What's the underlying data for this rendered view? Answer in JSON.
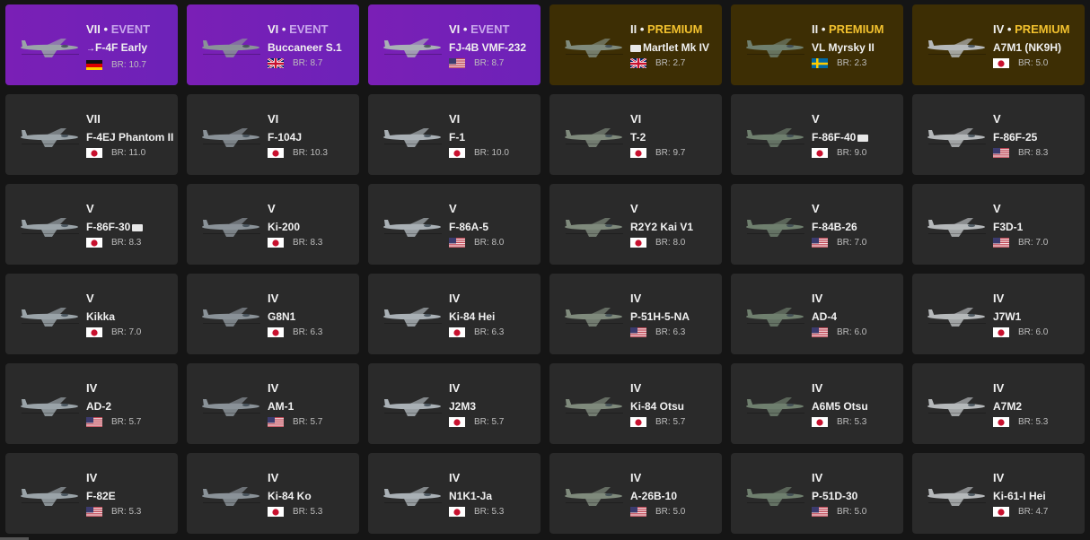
{
  "vehicles": [
    {
      "rank": "VII",
      "tag": "EVENT",
      "name": "F-4F Early",
      "country": "germany",
      "br": "BR: 10.7",
      "kind": "event",
      "prefix": "arrow",
      "suffix": ""
    },
    {
      "rank": "VI",
      "tag": "EVENT",
      "name": "Buccaneer S.1",
      "country": "uk",
      "br": "BR: 8.7",
      "kind": "event",
      "prefix": "",
      "suffix": ""
    },
    {
      "rank": "VI",
      "tag": "EVENT",
      "name": "FJ-4B VMF-232",
      "country": "usa",
      "br": "BR: 8.7",
      "kind": "event",
      "prefix": "",
      "suffix": ""
    },
    {
      "rank": "II",
      "tag": "PREMIUM",
      "name": "Martlet Mk IV",
      "country": "uk",
      "br": "BR: 2.7",
      "kind": "premium",
      "prefix": "box",
      "suffix": ""
    },
    {
      "rank": "II",
      "tag": "PREMIUM",
      "name": "VL Myrsky II",
      "country": "sweden",
      "br": "BR: 2.3",
      "kind": "premium",
      "prefix": "",
      "suffix": ""
    },
    {
      "rank": "IV",
      "tag": "PREMIUM",
      "name": "A7M1 (NK9H)",
      "country": "japan",
      "br": "BR: 5.0",
      "kind": "premium",
      "prefix": "",
      "suffix": ""
    },
    {
      "rank": "VII",
      "tag": "",
      "name": "F-4EJ Phantom II",
      "country": "japan",
      "br": "BR: 11.0",
      "kind": "normal",
      "prefix": "",
      "suffix": ""
    },
    {
      "rank": "VI",
      "tag": "",
      "name": "F-104J",
      "country": "japan",
      "br": "BR: 10.3",
      "kind": "normal",
      "prefix": "",
      "suffix": ""
    },
    {
      "rank": "VI",
      "tag": "",
      "name": "F-1",
      "country": "japan",
      "br": "BR: 10.0",
      "kind": "normal",
      "prefix": "",
      "suffix": ""
    },
    {
      "rank": "VI",
      "tag": "",
      "name": "T-2",
      "country": "japan",
      "br": "BR: 9.7",
      "kind": "normal",
      "prefix": "",
      "suffix": ""
    },
    {
      "rank": "V",
      "tag": "",
      "name": "F-86F-40",
      "country": "japan",
      "br": "BR: 9.0",
      "kind": "normal",
      "prefix": "",
      "suffix": "box"
    },
    {
      "rank": "V",
      "tag": "",
      "name": "F-86F-25",
      "country": "usa",
      "br": "BR: 8.3",
      "kind": "normal",
      "prefix": "",
      "suffix": ""
    },
    {
      "rank": "V",
      "tag": "",
      "name": "F-86F-30",
      "country": "japan",
      "br": "BR: 8.3",
      "kind": "normal",
      "prefix": "",
      "suffix": "box"
    },
    {
      "rank": "V",
      "tag": "",
      "name": "Ki-200",
      "country": "japan",
      "br": "BR: 8.3",
      "kind": "normal",
      "prefix": "",
      "suffix": ""
    },
    {
      "rank": "V",
      "tag": "",
      "name": "F-86A-5",
      "country": "usa",
      "br": "BR: 8.0",
      "kind": "normal",
      "prefix": "",
      "suffix": ""
    },
    {
      "rank": "V",
      "tag": "",
      "name": "R2Y2 Kai V1",
      "country": "japan",
      "br": "BR: 8.0",
      "kind": "normal",
      "prefix": "",
      "suffix": ""
    },
    {
      "rank": "V",
      "tag": "",
      "name": "F-84B-26",
      "country": "usa",
      "br": "BR: 7.0",
      "kind": "normal",
      "prefix": "",
      "suffix": ""
    },
    {
      "rank": "V",
      "tag": "",
      "name": "F3D-1",
      "country": "usa",
      "br": "BR: 7.0",
      "kind": "normal",
      "prefix": "",
      "suffix": ""
    },
    {
      "rank": "V",
      "tag": "",
      "name": "Kikka",
      "country": "japan",
      "br": "BR: 7.0",
      "kind": "normal",
      "prefix": "",
      "suffix": ""
    },
    {
      "rank": "IV",
      "tag": "",
      "name": "G8N1",
      "country": "japan",
      "br": "BR: 6.3",
      "kind": "normal",
      "prefix": "",
      "suffix": ""
    },
    {
      "rank": "IV",
      "tag": "",
      "name": "Ki-84 Hei",
      "country": "japan",
      "br": "BR: 6.3",
      "kind": "normal",
      "prefix": "",
      "suffix": ""
    },
    {
      "rank": "IV",
      "tag": "",
      "name": "P-51H-5-NA",
      "country": "usa",
      "br": "BR: 6.3",
      "kind": "normal",
      "prefix": "",
      "suffix": ""
    },
    {
      "rank": "IV",
      "tag": "",
      "name": "AD-4",
      "country": "usa",
      "br": "BR: 6.0",
      "kind": "normal",
      "prefix": "",
      "suffix": ""
    },
    {
      "rank": "IV",
      "tag": "",
      "name": "J7W1",
      "country": "japan",
      "br": "BR: 6.0",
      "kind": "normal",
      "prefix": "",
      "suffix": ""
    },
    {
      "rank": "IV",
      "tag": "",
      "name": "AD-2",
      "country": "usa",
      "br": "BR: 5.7",
      "kind": "normal",
      "prefix": "",
      "suffix": ""
    },
    {
      "rank": "IV",
      "tag": "",
      "name": "AM-1",
      "country": "usa",
      "br": "BR: 5.7",
      "kind": "normal",
      "prefix": "",
      "suffix": ""
    },
    {
      "rank": "IV",
      "tag": "",
      "name": "J2M3",
      "country": "japan",
      "br": "BR: 5.7",
      "kind": "normal",
      "prefix": "",
      "suffix": ""
    },
    {
      "rank": "IV",
      "tag": "",
      "name": "Ki-84 Otsu",
      "country": "japan",
      "br": "BR: 5.7",
      "kind": "normal",
      "prefix": "",
      "suffix": ""
    },
    {
      "rank": "IV",
      "tag": "",
      "name": "A6M5 Otsu",
      "country": "japan",
      "br": "BR: 5.3",
      "kind": "normal",
      "prefix": "",
      "suffix": ""
    },
    {
      "rank": "IV",
      "tag": "",
      "name": "A7M2",
      "country": "japan",
      "br": "BR: 5.3",
      "kind": "normal",
      "prefix": "",
      "suffix": ""
    },
    {
      "rank": "IV",
      "tag": "",
      "name": "F-82E",
      "country": "usa",
      "br": "BR: 5.3",
      "kind": "normal",
      "prefix": "",
      "suffix": ""
    },
    {
      "rank": "IV",
      "tag": "",
      "name": "Ki-84 Ko",
      "country": "japan",
      "br": "BR: 5.3",
      "kind": "normal",
      "prefix": "",
      "suffix": ""
    },
    {
      "rank": "IV",
      "tag": "",
      "name": "N1K1-Ja",
      "country": "japan",
      "br": "BR: 5.3",
      "kind": "normal",
      "prefix": "",
      "suffix": ""
    },
    {
      "rank": "IV",
      "tag": "",
      "name": "A-26B-10",
      "country": "usa",
      "br": "BR: 5.0",
      "kind": "normal",
      "prefix": "",
      "suffix": ""
    },
    {
      "rank": "IV",
      "tag": "",
      "name": "P-51D-30",
      "country": "usa",
      "br": "BR: 5.0",
      "kind": "normal",
      "prefix": "",
      "suffix": ""
    },
    {
      "rank": "IV",
      "tag": "",
      "name": "Ki-61-I Hei",
      "country": "japan",
      "br": "BR: 4.7",
      "kind": "normal",
      "prefix": "",
      "suffix": ""
    }
  ],
  "separator": " • ",
  "colors": {
    "event_bg": "#7a1fb6",
    "premium_bg": "#3d2e04",
    "card_bg": "#2a2a2a",
    "premium_text": "#f2c12e",
    "event_text": "#c9a8ec"
  }
}
